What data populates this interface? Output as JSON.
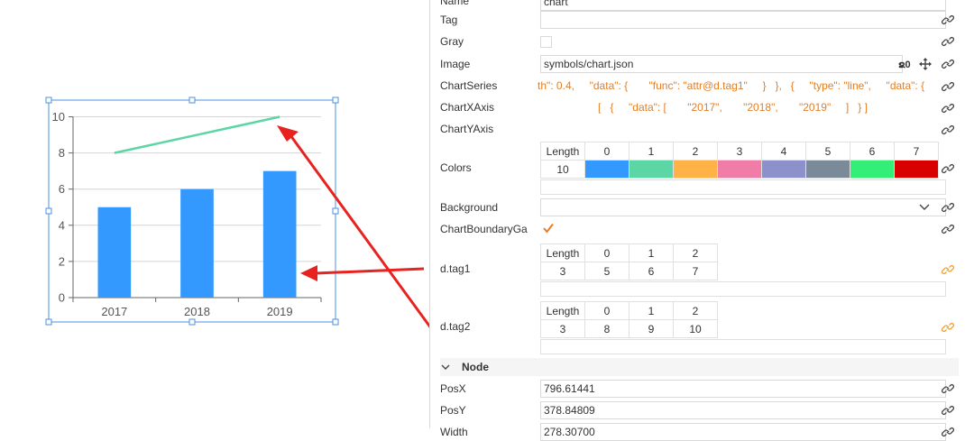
{
  "chart_data": {
    "type": "bar",
    "categories": [
      "2017",
      "2018",
      "2019"
    ],
    "series": [
      {
        "type": "bar",
        "values": [
          5,
          6,
          7
        ]
      },
      {
        "type": "line",
        "values": [
          8,
          9,
          10
        ]
      }
    ],
    "ylim": [
      0,
      10
    ],
    "yticks": [
      "0",
      "2",
      "4",
      "6",
      "8",
      "10"
    ],
    "grid": true
  },
  "colors": {
    "bar": "#3399ff",
    "line": "#5cd6a4",
    "arrow": "#e8231f",
    "selection": "#4a90e2",
    "link_icon": "#444444",
    "link_icon_bound": "#f0a030",
    "code_text": "#e67e22"
  },
  "props": {
    "name_label": "Name",
    "name_value": "chart",
    "tag_label": "Tag",
    "tag_value": "",
    "gray_label": "Gray",
    "image_label": "Image",
    "image_value": "symbols/chart.json",
    "image_suffix": "ຂ0",
    "chart_series_label": "ChartSeries",
    "chart_series_value": "th\": 0.4,     \"data\": {       \"func\": \"attr@d.tag1\"     }   },   {     \"type\": \"line\",     \"data\": {",
    "chart_xaxis_label": "ChartXAxis",
    "chart_xaxis_value": "[   {     \"data\": [       \"2017\",       \"2018\",       \"2019\"     ]   } ]",
    "chart_yaxis_label": "ChartYAxis",
    "colors_label": "Colors",
    "background_label": "Background",
    "background_value": "",
    "boundary_label": "ChartBoundaryGap",
    "dtag1_label": "d.tag1",
    "dtag2_label": "d.tag2",
    "length_label": "Length",
    "node_section": "Node",
    "posx_label": "PosX",
    "posx_value": "796.61441",
    "posy_label": "PosY",
    "posy_value": "378.84809",
    "width_label": "Width",
    "width_value": "278.30700"
  },
  "colors_table": {
    "length": "10",
    "headers": [
      "0",
      "1",
      "2",
      "3",
      "4",
      "5",
      "6",
      "7"
    ],
    "swatches": [
      "#3399ff",
      "#5cd6a4",
      "#ffb347",
      "#f07da8",
      "#8c91cc",
      "#7a8a99",
      "#33ee77",
      "#d90000"
    ]
  },
  "tag1_table": {
    "length": "3",
    "headers": [
      "0",
      "1",
      "2"
    ],
    "values": [
      "5",
      "6",
      "7"
    ]
  },
  "tag2_table": {
    "length": "3",
    "headers": [
      "0",
      "1",
      "2"
    ],
    "values": [
      "8",
      "9",
      "10"
    ]
  }
}
